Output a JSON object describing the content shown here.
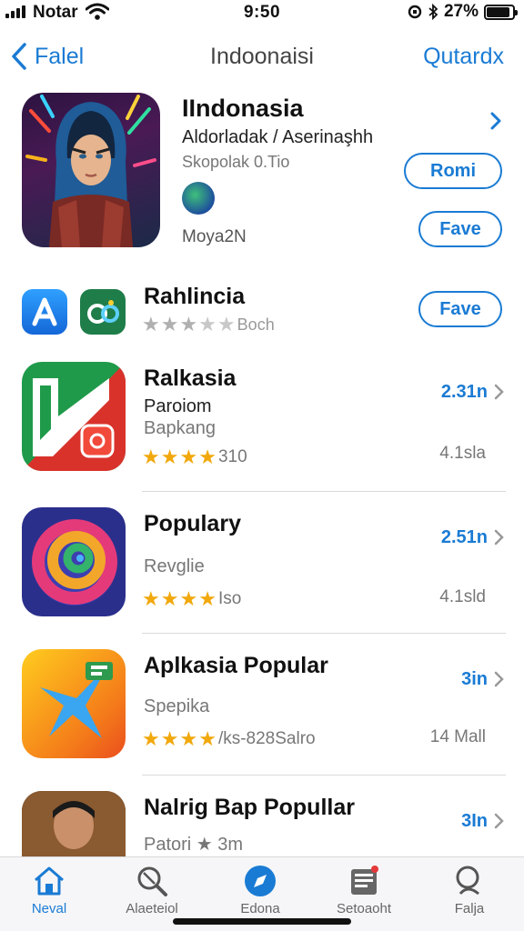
{
  "status_bar": {
    "carrier": "Notar",
    "time": "9:50",
    "battery": "27%"
  },
  "nav": {
    "back_label": "Falel",
    "title": "Indoonaisi",
    "right_label": "Qutardx"
  },
  "featured": {
    "title": "IIndonasia",
    "subtitle": "Aldorladak / Aserinaşhh",
    "subtitle2": "Skopolak 0.Tio",
    "developer": "Moya2N",
    "button_primary": "Romi",
    "button_secondary": "Fave"
  },
  "row1": {
    "title": "Rahlincia",
    "rating_text": "Boch",
    "stars": 3,
    "button": "Fave"
  },
  "apps": [
    {
      "title": "Ralkasia",
      "line2": "Paroiom",
      "line3": "Bapkang",
      "stars": 4,
      "rating_text": "310",
      "size": "2.31n",
      "meta": "4.1sla"
    },
    {
      "title": "Populary",
      "line2": "",
      "line3": "Revglie",
      "stars": 4,
      "rating_text": "Iso",
      "size": "2.51n",
      "meta": "4.1sld"
    },
    {
      "title": "Aplkasia Popular",
      "line2": "",
      "line3": "Spepika",
      "stars": 4,
      "rating_text": "/ks-828Salro",
      "size": "3in",
      "meta": "14 Mall"
    },
    {
      "title": "Nalrig Bap Popullar",
      "line2": "",
      "line3": "Patori ★ 3m",
      "stars": 0,
      "rating_text": "",
      "size": "3In",
      "meta": ""
    }
  ],
  "tabs": [
    {
      "label": "Neval",
      "icon": "home-icon",
      "active": true
    },
    {
      "label": "Alaeteiol",
      "icon": "search-magnifier-icon",
      "active": false
    },
    {
      "label": "Edona",
      "icon": "compass-icon",
      "active": false
    },
    {
      "label": "Setoaoht",
      "icon": "tray-icon",
      "active": false
    },
    {
      "label": "Falja",
      "icon": "search-icon",
      "active": false
    }
  ],
  "colors": {
    "accent": "#1a7bd4",
    "star": "#f1a80c"
  }
}
